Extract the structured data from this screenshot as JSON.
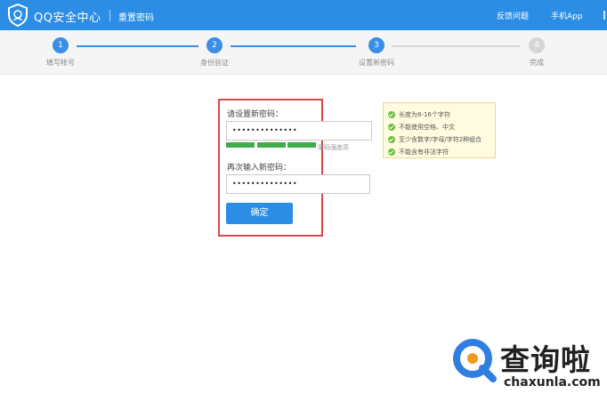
{
  "header": {
    "brand": "QQ安全中心",
    "subtitle": "重置密码",
    "links": {
      "feedback": "反馈问题",
      "app": "手机App"
    }
  },
  "steps": [
    {
      "number": "1",
      "label": "填写帐号",
      "status": "done"
    },
    {
      "number": "2",
      "label": "身份验证",
      "status": "done"
    },
    {
      "number": "3",
      "label": "设置新密码",
      "status": "current"
    },
    {
      "number": "4",
      "label": "完成",
      "status": "pending"
    }
  ],
  "form": {
    "new_password_label": "请设置新密码：",
    "new_password_value": "••••••••••••••",
    "strength_label": "密码强度高",
    "strength_filled_segments": 3,
    "confirm_password_label": "再次输入新密码：",
    "confirm_password_value": "••••••••••••••",
    "submit_label": "确定"
  },
  "tips": [
    "长度为8-16个字符",
    "不能使用空格、中文",
    "至少含数字/字母/字符2种组合",
    "不能含有非法字符"
  ],
  "watermark": {
    "title": "查询啦",
    "domain": "chaxunla.com"
  },
  "colors": {
    "primary": "#2b8de4",
    "step_done": "#3a8ee6",
    "step_pending": "#d6d6d6",
    "strength": "#3fae49",
    "tip_check": "#6cbf3c",
    "highlight_border": "#d94848",
    "watermark_blue": "#2f7ee0",
    "watermark_orange": "#f29a1f"
  }
}
